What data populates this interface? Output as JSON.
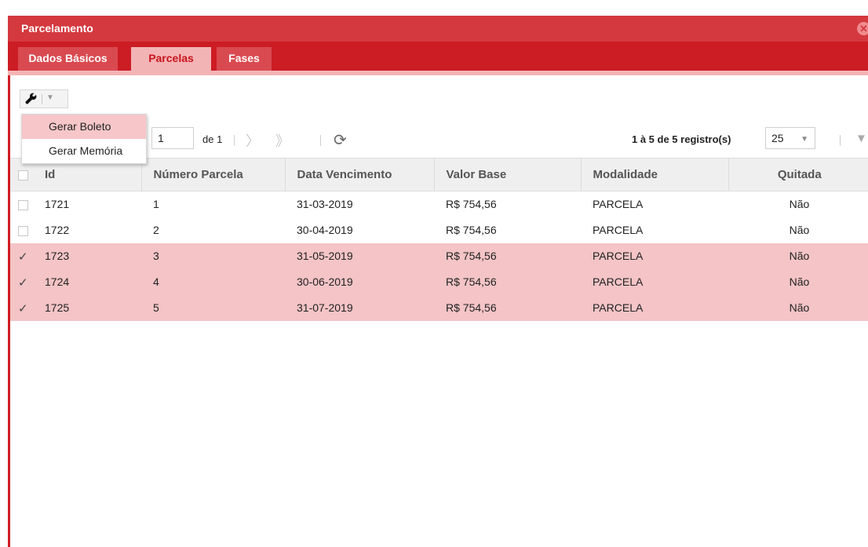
{
  "window": {
    "title": "Parcelamento",
    "close_icon": "close-circle-icon"
  },
  "tabs": [
    {
      "label": "Dados Básicos",
      "active": false
    },
    {
      "label": "Parcelas",
      "active": true
    },
    {
      "label": "Fases",
      "active": false
    }
  ],
  "toolbar": {
    "tool_icon": "wrench-icon",
    "caret_icon": "caret-down-icon"
  },
  "menu": {
    "items": [
      "Gerar Boleto",
      "Gerar Memória"
    ]
  },
  "pager": {
    "page_value": "1",
    "of_label": "de 1",
    "records": "1 à 5 de 5 registro(s)",
    "page_size": "25"
  },
  "table": {
    "headers": [
      "Id",
      "Número Parcela",
      "Data Vencimento",
      "Valor Base",
      "Modalidade",
      "Quitada"
    ],
    "rows": [
      {
        "selected": false,
        "cells": [
          "1721",
          "1",
          "31-03-2019",
          "R$ 754,56",
          "PARCELA",
          "Não"
        ]
      },
      {
        "selected": false,
        "cells": [
          "1722",
          "2",
          "30-04-2019",
          "R$ 754,56",
          "PARCELA",
          "Não"
        ]
      },
      {
        "selected": true,
        "cells": [
          "1723",
          "3",
          "31-05-2019",
          "R$ 754,56",
          "PARCELA",
          "Não"
        ]
      },
      {
        "selected": true,
        "cells": [
          "1724",
          "4",
          "30-06-2019",
          "R$ 754,56",
          "PARCELA",
          "Não"
        ]
      },
      {
        "selected": true,
        "cells": [
          "1725",
          "5",
          "31-07-2019",
          "R$ 754,56",
          "PARCELA",
          "Não"
        ]
      }
    ]
  },
  "colors": {
    "title_bar": "#d4393f",
    "tab_bar": "#cc1c24",
    "active_tab": "#f3b4b6",
    "selected_row": "#f4c4c6"
  }
}
